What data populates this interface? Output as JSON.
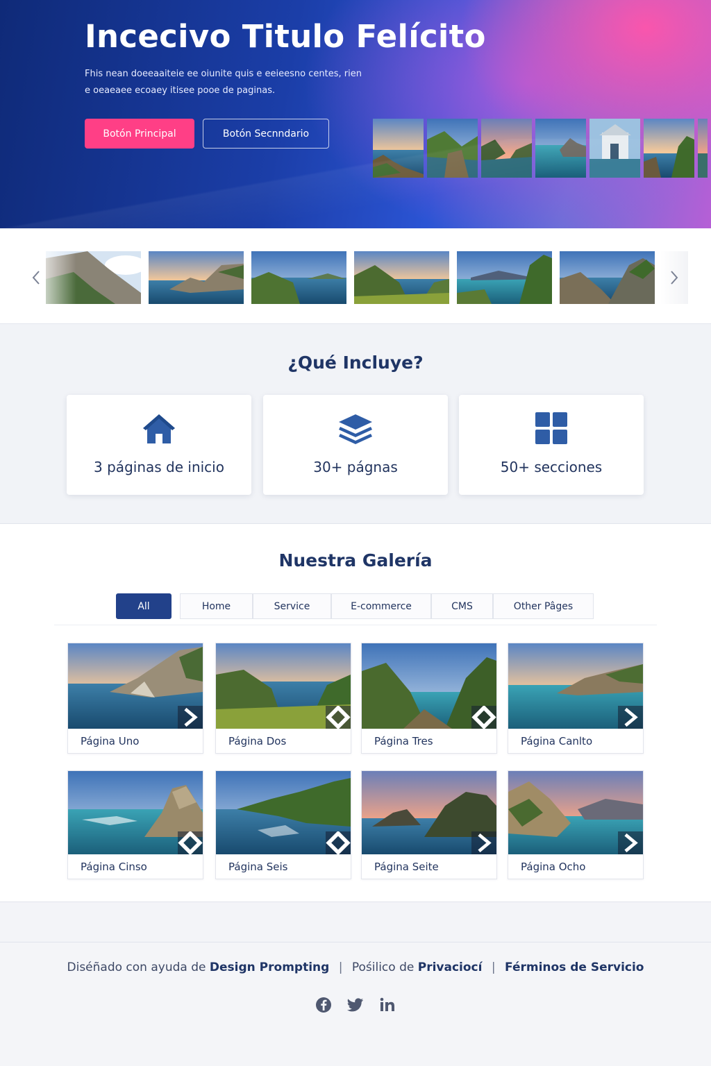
{
  "hero": {
    "title": "Incecivo Titulo Felícito",
    "description": "Fhis nean doeeaaiteie ee oiunite quis e eeieesno centes, rien e oeaeaee ecoaey itisee pooe de paginas.",
    "primary_button": "Botón Principal",
    "secondary_button": "Botón Secnndario"
  },
  "carousel": {
    "prev_icon": "chevron-left-icon",
    "next_icon": "chevron-right-icon"
  },
  "includes": {
    "title": "¿Qué Incluye?",
    "cards": [
      {
        "icon": "home-icon",
        "label": "3 páginas de inicio"
      },
      {
        "icon": "layers-icon",
        "label": "30+ págnas"
      },
      {
        "icon": "grid-icon",
        "label": "50+ secciones"
      }
    ]
  },
  "gallery": {
    "title": "Nuestra Galería",
    "filters": [
      "All",
      "Home",
      "Service",
      "E-commerce",
      "CMS",
      "Other Pâges"
    ],
    "active_filter": "All",
    "items": [
      {
        "caption": "Página Uno",
        "button_icon": "chevron-right-icon"
      },
      {
        "caption": "Página Dos",
        "button_icon": "diamond-icon"
      },
      {
        "caption": "Página Tres",
        "button_icon": "diamond-icon"
      },
      {
        "caption": "Página Canlto",
        "button_icon": "chevron-right-icon"
      },
      {
        "caption": "Página Cinso",
        "button_icon": "diamond-icon"
      },
      {
        "caption": "Página Seis",
        "button_icon": "diamond-icon"
      },
      {
        "caption": "Página Seite",
        "button_icon": "chevron-right-icon"
      },
      {
        "caption": "Página Ocho",
        "button_icon": "chevron-right-icon"
      }
    ]
  },
  "footer": {
    "prefix": "Diséñado con ayuda de",
    "brand": "Design Prompting",
    "privacy_prefix": "Pośilico de",
    "privacy_bold": "Privaciocí",
    "terms": "Férminos de Servicio",
    "separator": "|",
    "socials": [
      "facebook-icon",
      "twitter-icon",
      "linkedin-icon"
    ]
  },
  "colors": {
    "primary_button": "#ff3f86",
    "brand_navy": "#22418a",
    "heading": "#1f3566"
  }
}
